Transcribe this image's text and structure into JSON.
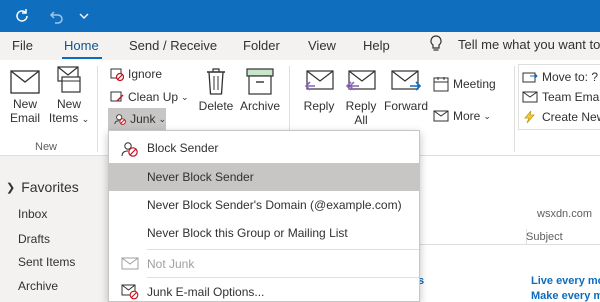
{
  "quick_access": {
    "sync_icon": "sync-icon",
    "undo_icon": "undo-icon",
    "more_icon": "chevron-down-icon"
  },
  "tabs": [
    {
      "label": "File"
    },
    {
      "label": "Home"
    },
    {
      "label": "Send / Receive"
    },
    {
      "label": "Folder"
    },
    {
      "label": "View"
    },
    {
      "label": "Help"
    }
  ],
  "tell_me": "Tell me what you want to",
  "ribbon": {
    "new_email": "New Email",
    "new_email_l1": "New",
    "new_email_l2": "Email",
    "new_items_l1": "New",
    "new_items_l2": "Items",
    "new_group": "New",
    "ignore": "Ignore",
    "clean_up": "Clean Up",
    "junk": "Junk",
    "delete": "Delete",
    "archive": "Archive",
    "reply": "Reply",
    "reply_all_l1": "Reply",
    "reply_all_l2": "All",
    "forward": "Forward",
    "meeting": "Meeting",
    "more": "More",
    "move_to": "Move to: ?",
    "team_email": "Team Email",
    "create_new": "Create New"
  },
  "junk_menu": {
    "items": [
      {
        "label": "Block Sender",
        "enabled": true
      },
      {
        "label": "Never Block Sender",
        "enabled": true,
        "highlighted": true
      },
      {
        "label": "Never Block Sender's Domain (@example.com)",
        "enabled": true
      },
      {
        "label": "Never Block this Group or Mailing List",
        "enabled": true
      },
      {
        "label": "Not Junk",
        "enabled": false
      },
      {
        "label": "Junk E-mail Options...",
        "enabled": true
      }
    ]
  },
  "folders": {
    "favorites": "Favorites",
    "items": [
      "Inbox",
      "Drafts",
      "Sent Items",
      "Archive"
    ]
  },
  "list": {
    "subject_header": "Subject",
    "s_fragment": "s",
    "rows": [
      "Live every mo",
      "Make every mo"
    ]
  },
  "watermark": "wsxdn.com",
  "colors": {
    "titlebar": "#106ebe",
    "accent": "#0f6cbd",
    "highlight": "#c8c6c4"
  }
}
